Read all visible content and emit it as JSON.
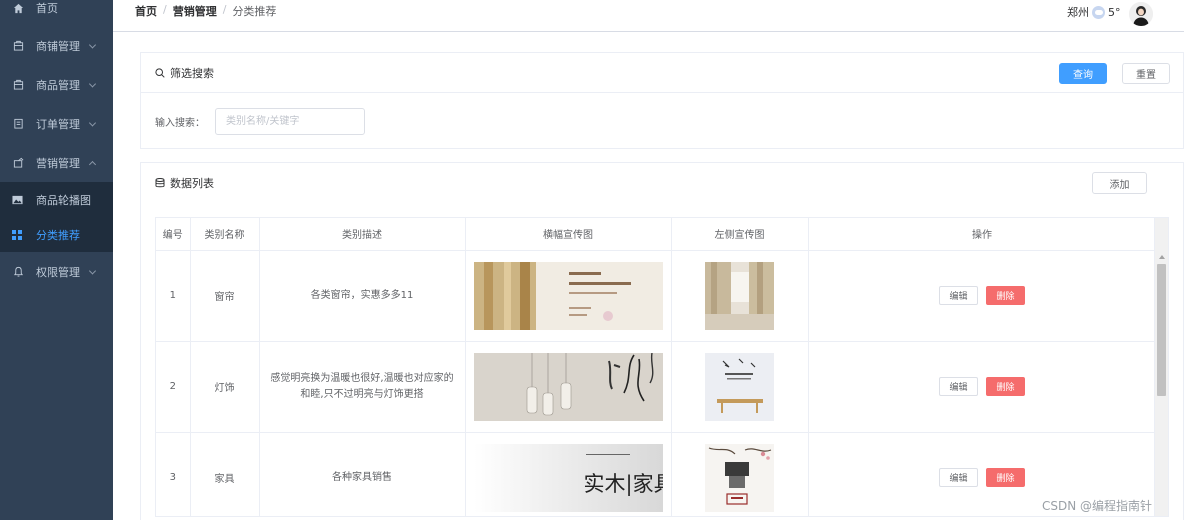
{
  "sidebar": {
    "items": [
      {
        "label": "首页",
        "icon": "home-icon"
      },
      {
        "label": "商铺管理",
        "icon": "shop-icon"
      },
      {
        "label": "商品管理",
        "icon": "goods-icon"
      },
      {
        "label": "订单管理",
        "icon": "order-icon"
      },
      {
        "label": "营销管理",
        "icon": "marketing-icon"
      },
      {
        "label": "权限管理",
        "icon": "bell-icon"
      }
    ],
    "submenu": [
      {
        "label": "商品轮播图",
        "icon": "image-icon"
      },
      {
        "label": "分类推荐",
        "icon": "grid-icon"
      }
    ]
  },
  "header": {
    "breadcrumb": [
      "首页",
      "营销管理",
      "分类推荐"
    ],
    "city": "郑州",
    "temperature": "5°"
  },
  "filter": {
    "title": "筛选搜索",
    "query_label": "查询",
    "reset_label": "重置",
    "search_label": "输入搜索：",
    "search_placeholder": "类别名称/关键字"
  },
  "list": {
    "title": "数据列表",
    "add_label": "添加",
    "columns": [
      "编号",
      "类别名称",
      "类别描述",
      "横幅宣传图",
      "左侧宣传图",
      "操作"
    ],
    "rows": [
      {
        "id": "1",
        "name": "窗帘",
        "desc": "各类窗帘，实惠多多11"
      },
      {
        "id": "2",
        "name": "灯饰",
        "desc": "感觉明亮换为温暖也很好,温暖也对应家的和睦,只不过明亮与灯饰更搭"
      },
      {
        "id": "3",
        "name": "家具",
        "desc": "各种家具销售",
        "banner_text": "实木|家具"
      }
    ],
    "edit_label": "编辑",
    "delete_label": "删除"
  },
  "watermark": "CSDN @编程指南针",
  "colors": {
    "sidebar_bg": "#304156",
    "active": "#409eff",
    "danger": "#f56c6c"
  }
}
